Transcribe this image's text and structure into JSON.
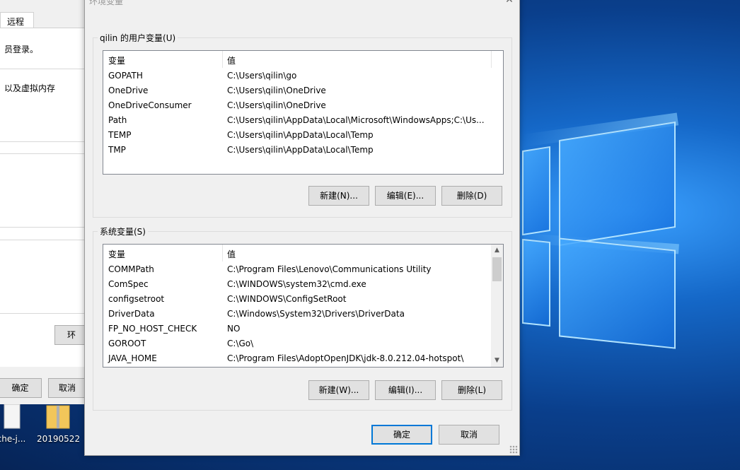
{
  "back_window": {
    "tab_label": "远程",
    "line1": "员登录。",
    "line2": "以及虚拟内存",
    "partial_button": "环",
    "ok_label": "确定",
    "cancel_label": "取消"
  },
  "desktop": {
    "icons": [
      {
        "label": "che-j...",
        "icon": "file-icon"
      },
      {
        "label": "20190522...",
        "icon": "zip-folder-icon"
      }
    ]
  },
  "dialog": {
    "title": "环境变量",
    "user_group": {
      "title": "qilin 的用户变量(U)",
      "col_var": "变量",
      "col_val": "值",
      "rows": [
        {
          "name": "GOPATH",
          "value": "C:\\Users\\qilin\\go"
        },
        {
          "name": "OneDrive",
          "value": "C:\\Users\\qilin\\OneDrive"
        },
        {
          "name": "OneDriveConsumer",
          "value": "C:\\Users\\qilin\\OneDrive"
        },
        {
          "name": "Path",
          "value": "C:\\Users\\qilin\\AppData\\Local\\Microsoft\\WindowsApps;C:\\Us..."
        },
        {
          "name": "TEMP",
          "value": "C:\\Users\\qilin\\AppData\\Local\\Temp"
        },
        {
          "name": "TMP",
          "value": "C:\\Users\\qilin\\AppData\\Local\\Temp"
        }
      ],
      "buttons": {
        "new": "新建(N)...",
        "edit": "编辑(E)...",
        "delete": "删除(D)"
      }
    },
    "system_group": {
      "title": "系统变量(S)",
      "col_var": "变量",
      "col_val": "值",
      "rows": [
        {
          "name": "COMMPath",
          "value": "C:\\Program Files\\Lenovo\\Communications Utility"
        },
        {
          "name": "ComSpec",
          "value": "C:\\WINDOWS\\system32\\cmd.exe"
        },
        {
          "name": "configsetroot",
          "value": "C:\\WINDOWS\\ConfigSetRoot"
        },
        {
          "name": "DriverData",
          "value": "C:\\Windows\\System32\\Drivers\\DriverData"
        },
        {
          "name": "FP_NO_HOST_CHECK",
          "value": "NO"
        },
        {
          "name": "GOROOT",
          "value": "C:\\Go\\"
        },
        {
          "name": "JAVA_HOME",
          "value": "C:\\Program Files\\AdoptOpenJDK\\jdk-8.0.212.04-hotspot\\"
        }
      ],
      "buttons": {
        "new": "新建(W)...",
        "edit": "编辑(I)...",
        "delete": "删除(L)"
      }
    },
    "ok_label": "确定",
    "cancel_label": "取消"
  }
}
